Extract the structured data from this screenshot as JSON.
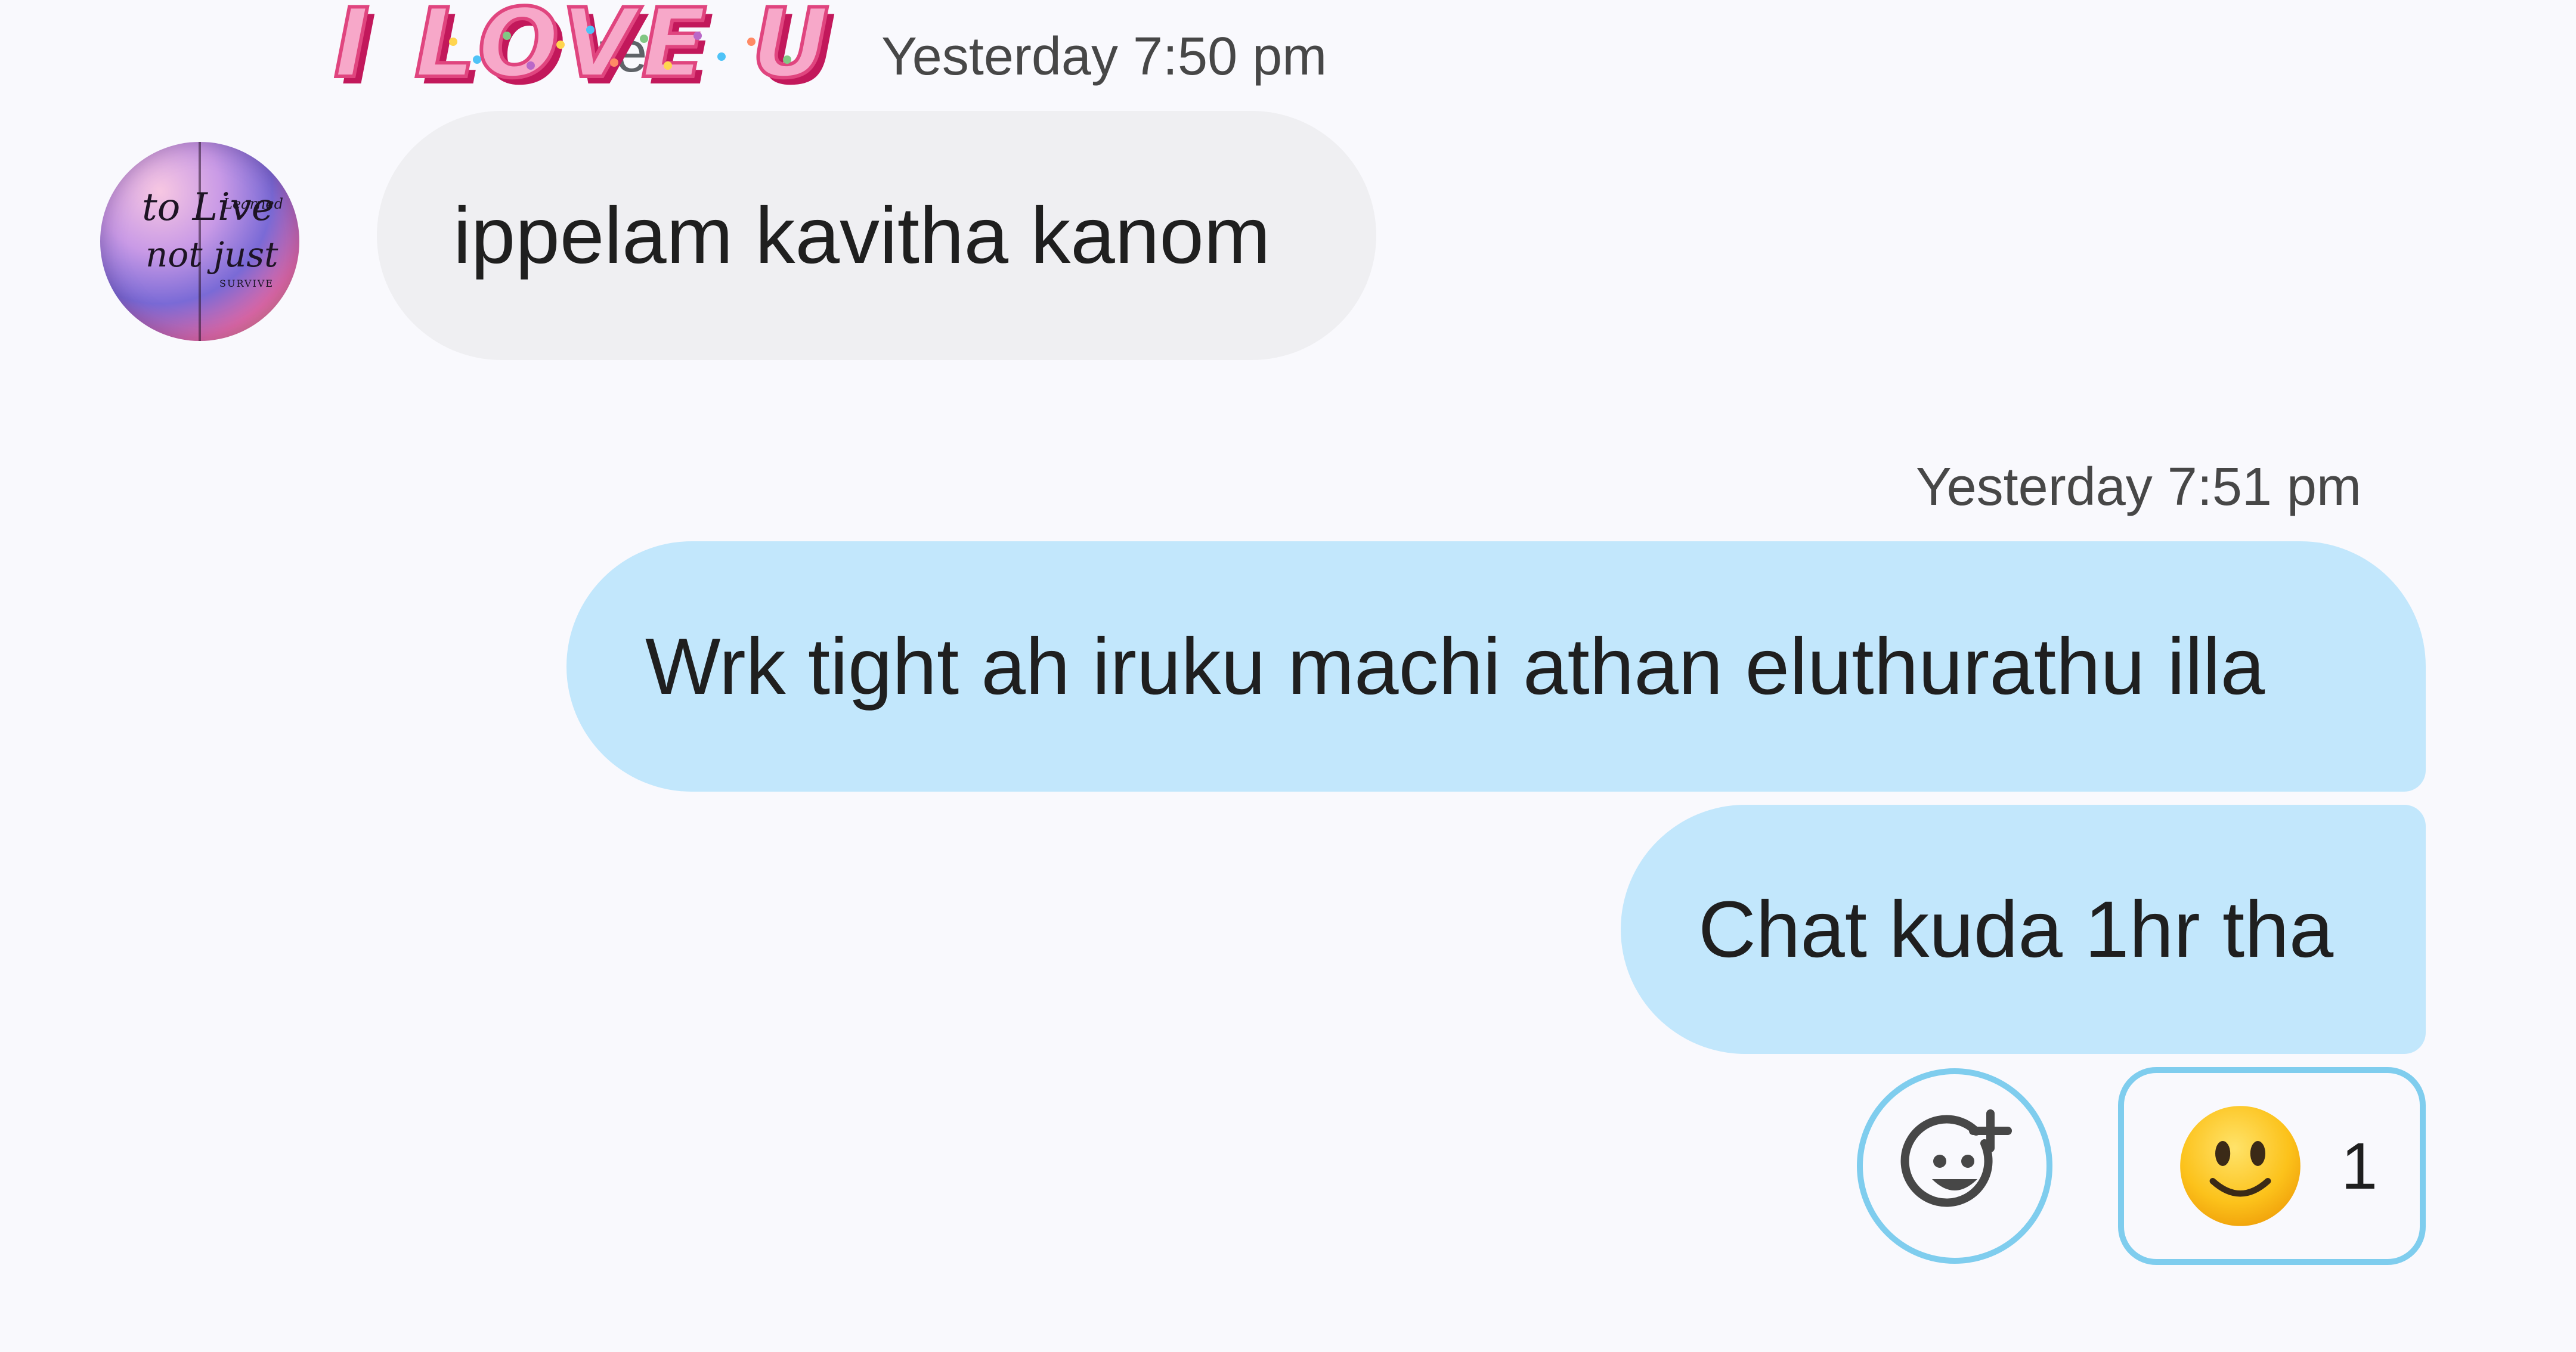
{
  "sticker": {
    "text": "I LOVE U"
  },
  "incoming": {
    "sender_name_partial": "re",
    "timestamp": "Yesterday 7:50 pm",
    "avatar": {
      "line1": "to Live",
      "line2": "not just",
      "line3": "Learned",
      "line4": "SURVIVE"
    },
    "message": "ippelam kavitha kanom"
  },
  "outgoing": {
    "timestamp": "Yesterday 7:51 pm",
    "messages": [
      "Wrk tight ah iruku machi athan eluthurathu illa",
      "Chat kuda 1hr tha"
    ]
  },
  "reactions": {
    "add_icon": "add-reaction-icon",
    "items": [
      {
        "emoji": "slightly-smiling-face",
        "count": "1"
      }
    ]
  },
  "colors": {
    "background": "#f9f9fd",
    "incoming_bubble": "#efeff2",
    "outgoing_bubble": "#c2e7fc",
    "reaction_border": "#7fcdee",
    "sticker_pink": "#f062a0"
  }
}
